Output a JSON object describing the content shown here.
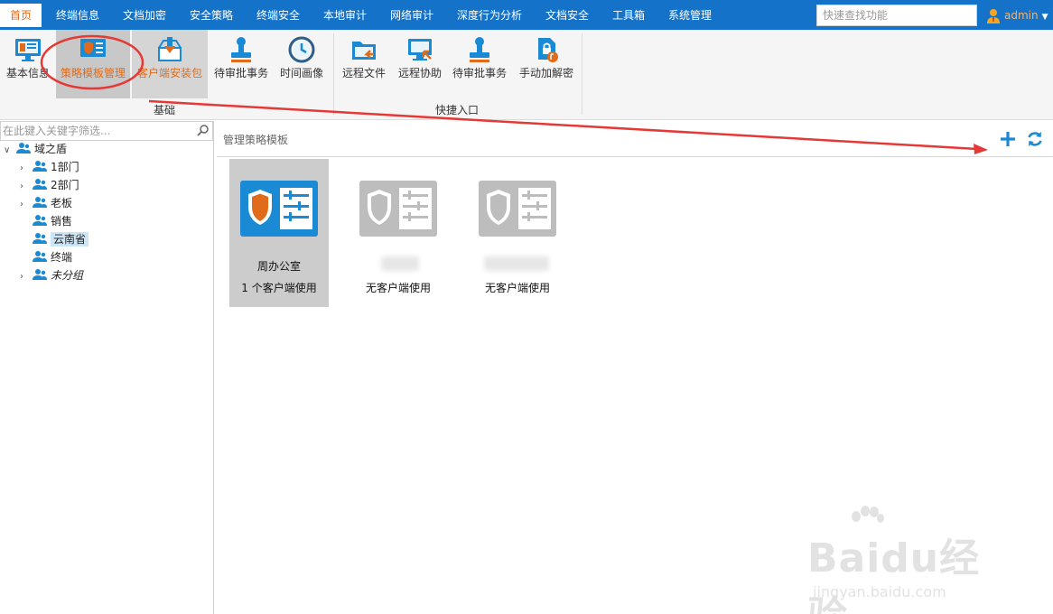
{
  "nav": {
    "tabs": [
      "首页",
      "终端信息",
      "文档加密",
      "安全策略",
      "终端安全",
      "本地审计",
      "网络审计",
      "深度行为分析",
      "文档安全",
      "工具箱",
      "系统管理"
    ],
    "search_placeholder": "快速查找功能",
    "user": "admin"
  },
  "ribbon": {
    "buttons": [
      "基本信息",
      "策略模板管理",
      "客户端安装包",
      "待审批事务",
      "时间画像",
      "远程文件",
      "远程协助",
      "待审批事务",
      "手动加解密"
    ],
    "groups": [
      "基础",
      "快捷入口"
    ]
  },
  "left": {
    "filter_placeholder": "在此键入关键字筛选...",
    "tree": [
      "域之盾",
      "1部门",
      "2部门",
      "老板",
      "销售",
      "云南省",
      "终端",
      "未分组"
    ]
  },
  "main": {
    "title": "管理策略模板",
    "cards": [
      {
        "name": "周办公室",
        "count": "1 个客户端使用"
      },
      {
        "name": "",
        "count": "无客户端使用"
      },
      {
        "name": "",
        "count": "无客户端使用"
      }
    ]
  },
  "watermark": {
    "brand": "Baidu经验",
    "url": "jingyan.baidu.com"
  },
  "colors": {
    "nav_bg": "#1473c9",
    "accent_orange": "#e06b1a",
    "icon_blue": "#1a8ad4",
    "annotation_red": "#e53935"
  }
}
